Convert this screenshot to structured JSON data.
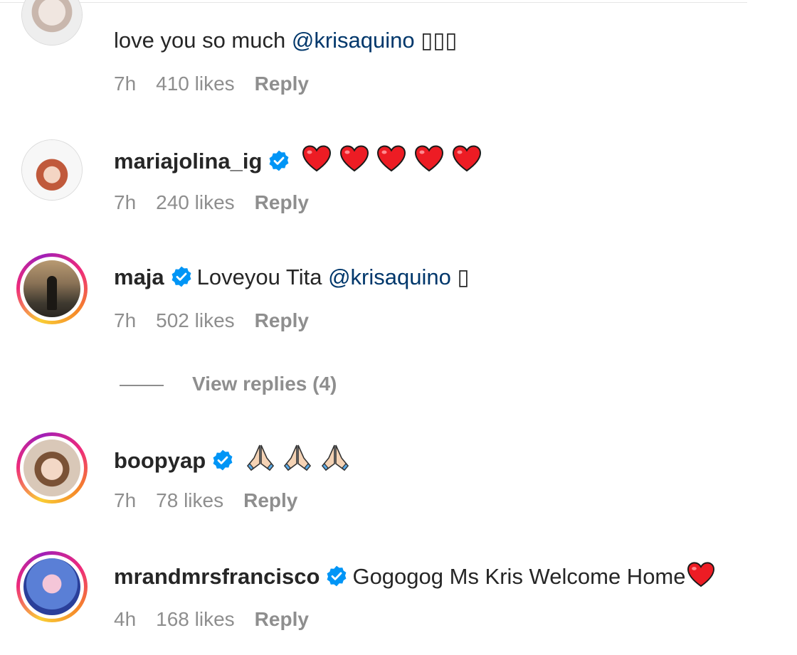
{
  "comments": [
    {
      "id": "c0",
      "username": "",
      "verified": false,
      "text_before": "love you so much ",
      "mention": "@krisaquino",
      "text_after": " ▯▯▯",
      "time": "7h",
      "likes": "410 likes",
      "reply": "Reply"
    },
    {
      "id": "c1",
      "username": "mariajolina_ig",
      "verified": true,
      "emoji": "heart",
      "emoji_count": 5,
      "time": "7h",
      "likes": "240 likes",
      "reply": "Reply"
    },
    {
      "id": "c2",
      "username": "maja",
      "verified": true,
      "text_before": "Loveyou Tita ",
      "mention": "@krisaquino",
      "text_after": " ▯",
      "time": "7h",
      "likes": "502 likes",
      "reply": "Reply"
    },
    {
      "id": "c3",
      "username": "boopyap",
      "verified": true,
      "emoji": "folded-hands",
      "emoji_count": 3,
      "time": "7h",
      "likes": "78 likes",
      "reply": "Reply"
    },
    {
      "id": "c4",
      "username": "mrandmrsfrancisco",
      "verified": true,
      "text_before": "Gogogog Ms Kris Welcome Home",
      "emoji": "heart",
      "time": "4h",
      "likes": "168 likes",
      "reply": "Reply"
    }
  ],
  "view_replies": "View replies (4)",
  "colors": {
    "text": "#262626",
    "muted": "#8e8e8e",
    "mention": "#00376b",
    "verified": "#0095f6",
    "heart": "#ed1c24"
  }
}
